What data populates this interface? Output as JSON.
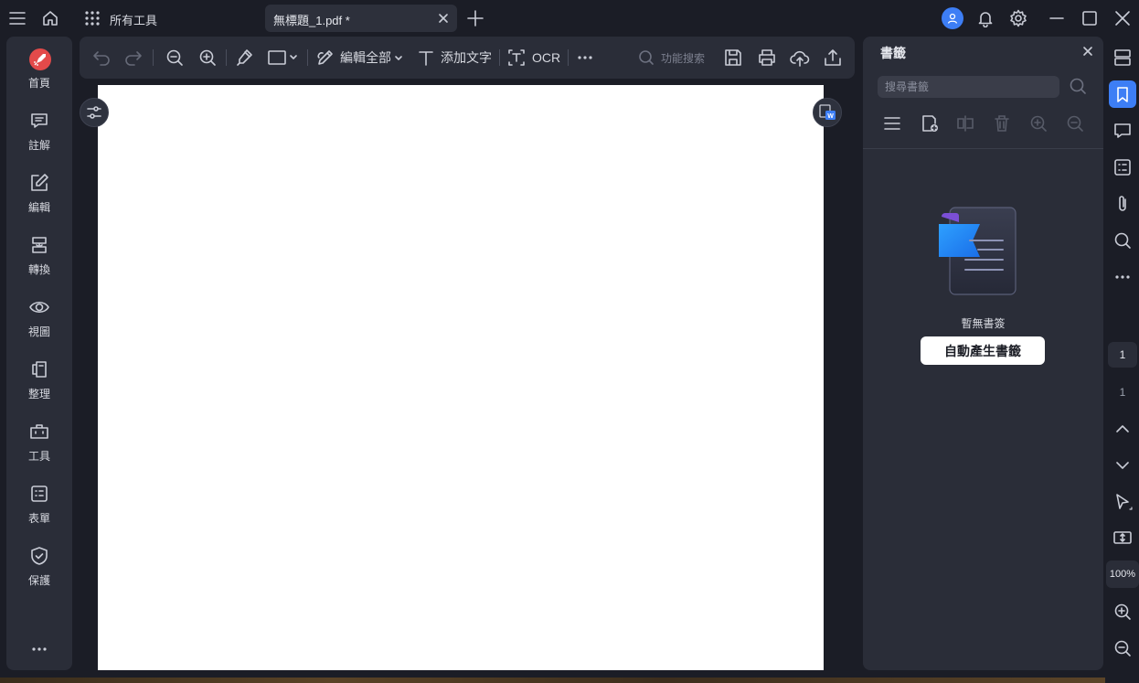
{
  "titlebar": {
    "all_tools_label": "所有工具",
    "tab_title": "無標題_1.pdf *"
  },
  "leftnav": {
    "items": [
      {
        "label": "首頁",
        "icon": "rocket-icon"
      },
      {
        "label": "註解",
        "icon": "comment-icon"
      },
      {
        "label": "編輯",
        "icon": "edit-icon"
      },
      {
        "label": "轉換",
        "icon": "convert-icon"
      },
      {
        "label": "視圖",
        "icon": "view-icon"
      },
      {
        "label": "整理",
        "icon": "organize-icon"
      },
      {
        "label": "工具",
        "icon": "toolbox-icon"
      },
      {
        "label": "表單",
        "icon": "form-icon"
      },
      {
        "label": "保護",
        "icon": "shield-icon"
      }
    ]
  },
  "toolbar": {
    "edit_all_label": "編輯全部",
    "add_text_label": "添加文字",
    "ocr_label": "OCR",
    "search_label": "功能搜索"
  },
  "bookmark_panel": {
    "title": "書籤",
    "search_placeholder": "搜尋書籤",
    "empty_text": "暫無書簽",
    "auto_generate_label": "自動產生書籤"
  },
  "right_strip": {
    "current_page": "1",
    "total_pages": "1",
    "zoom": "100%"
  },
  "colors": {
    "accent": "#3d7ef5",
    "background": "#1b1d26",
    "panel": "#2a2d38",
    "page": "#ffffff"
  }
}
